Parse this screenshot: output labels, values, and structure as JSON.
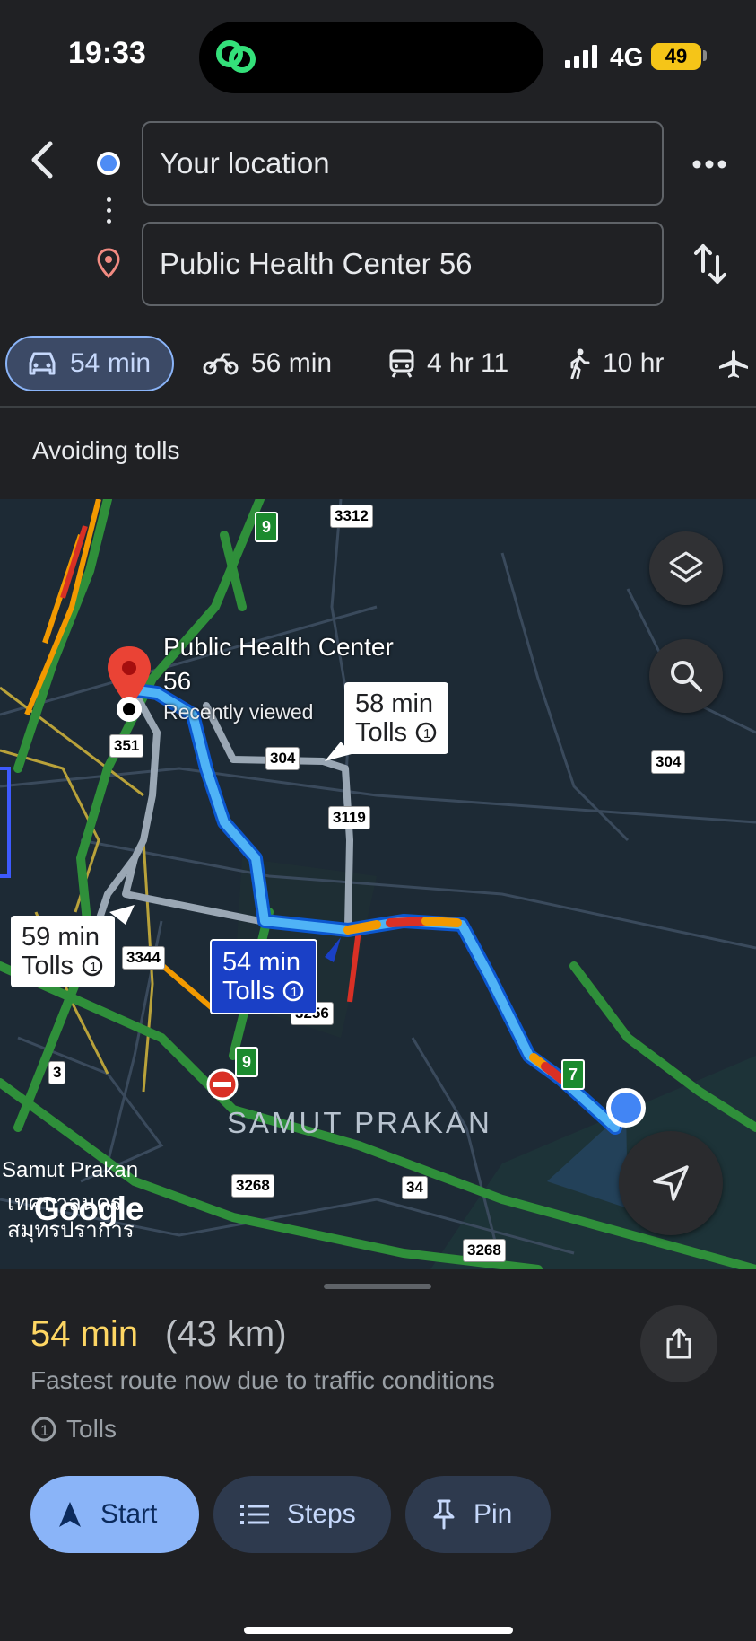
{
  "status_bar": {
    "time": "19:33",
    "network": "4G",
    "battery": "49",
    "icons": [
      "activity-link-icon",
      "signal-icon"
    ]
  },
  "search": {
    "origin": "Your location",
    "destination": "Public Health Center 56",
    "icons": [
      "back-icon",
      "more-icon",
      "swap-icon"
    ]
  },
  "modes": [
    {
      "name": "drive",
      "icon": "car-icon",
      "label": "54 min",
      "selected": true
    },
    {
      "name": "motorcycle",
      "icon": "motorcycle-icon",
      "label": "56 min"
    },
    {
      "name": "transit",
      "icon": "train-icon",
      "label": "4 hr 11"
    },
    {
      "name": "walk",
      "icon": "walk-icon",
      "label": "10 hr"
    },
    {
      "name": "flight",
      "icon": "plane-icon",
      "label": ""
    }
  ],
  "route_note": "Avoiding tolls",
  "map": {
    "place_name": "Public Health Center 56",
    "place_status": "Recently viewed",
    "area_label": "SAMUT PRAKAN",
    "city_label": "Samut Prakan",
    "city_label_thai": "เทศบาลนคร สมุทรปราการ",
    "logo": "Google",
    "callouts": {
      "alt1_time": "58 min",
      "alt1_tolls": "Tolls",
      "alt2_time": "59 min",
      "alt2_tolls": "Tolls",
      "main_time": "54 min",
      "main_tolls": "Tolls"
    },
    "shields": {
      "r3312": "3312",
      "r9a": "9",
      "r351": "351",
      "r304a": "304",
      "r304b": "304",
      "r3119": "3119",
      "r3344": "3344",
      "r3256": "3256",
      "r3": "3",
      "r9b": "9",
      "r7": "7",
      "r3268a": "3268",
      "r34": "34",
      "r3268b": "3268"
    },
    "colors": {
      "route_main": "#4fb3f6",
      "route_alt": "#9aa7b4",
      "traffic_slow": "#f29900",
      "traffic_heavy": "#d93025",
      "highway": "#2f8f3a"
    }
  },
  "summary": {
    "duration": "54 min",
    "distance": "(43 km)",
    "reason": "Fastest route now due to traffic conditions",
    "tolls": "Tolls"
  },
  "actions": {
    "start": "Start",
    "steps": "Steps",
    "pin": "Pin"
  }
}
